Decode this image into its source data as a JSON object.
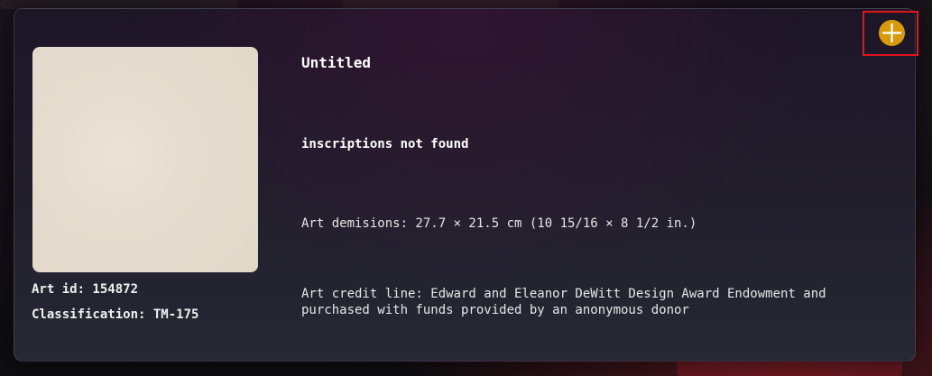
{
  "artwork": {
    "title": "Untitled",
    "inscriptions": "inscriptions not found",
    "dimensions": "Art demisions: 27.7 × 21.5 cm (10 15/16 × 8 1/2 in.)",
    "credit_line": "Art credit line: Edward and Eleanor DeWitt Design Award Endowment and purchased with funds provided by an anonymous donor",
    "id_label": "Art id: 154872",
    "classification_label": "Classification: TM-175"
  },
  "actions": {
    "add_icon": "plus-icon",
    "add_color": "#d99a0c",
    "highlight_color": "#e0161b"
  }
}
